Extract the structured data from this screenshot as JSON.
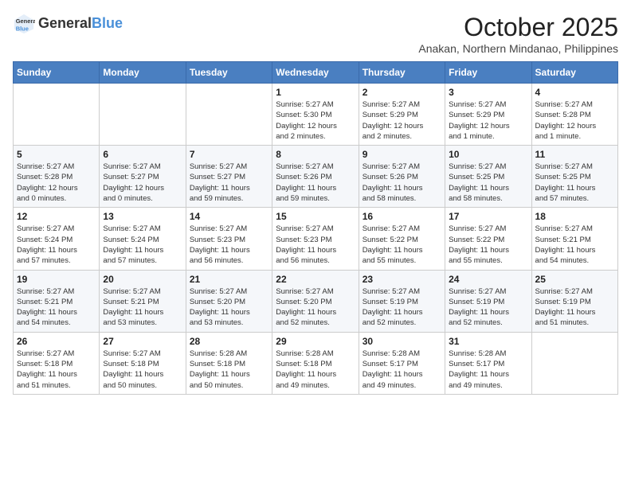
{
  "header": {
    "logo_general": "General",
    "logo_blue": "Blue",
    "month": "October 2025",
    "location": "Anakan, Northern Mindanao, Philippines"
  },
  "days_of_week": [
    "Sunday",
    "Monday",
    "Tuesday",
    "Wednesday",
    "Thursday",
    "Friday",
    "Saturday"
  ],
  "weeks": [
    [
      {
        "day": "",
        "info": ""
      },
      {
        "day": "",
        "info": ""
      },
      {
        "day": "",
        "info": ""
      },
      {
        "day": "1",
        "info": "Sunrise: 5:27 AM\nSunset: 5:30 PM\nDaylight: 12 hours\nand 2 minutes."
      },
      {
        "day": "2",
        "info": "Sunrise: 5:27 AM\nSunset: 5:29 PM\nDaylight: 12 hours\nand 2 minutes."
      },
      {
        "day": "3",
        "info": "Sunrise: 5:27 AM\nSunset: 5:29 PM\nDaylight: 12 hours\nand 1 minute."
      },
      {
        "day": "4",
        "info": "Sunrise: 5:27 AM\nSunset: 5:28 PM\nDaylight: 12 hours\nand 1 minute."
      }
    ],
    [
      {
        "day": "5",
        "info": "Sunrise: 5:27 AM\nSunset: 5:28 PM\nDaylight: 12 hours\nand 0 minutes."
      },
      {
        "day": "6",
        "info": "Sunrise: 5:27 AM\nSunset: 5:27 PM\nDaylight: 12 hours\nand 0 minutes."
      },
      {
        "day": "7",
        "info": "Sunrise: 5:27 AM\nSunset: 5:27 PM\nDaylight: 11 hours\nand 59 minutes."
      },
      {
        "day": "8",
        "info": "Sunrise: 5:27 AM\nSunset: 5:26 PM\nDaylight: 11 hours\nand 59 minutes."
      },
      {
        "day": "9",
        "info": "Sunrise: 5:27 AM\nSunset: 5:26 PM\nDaylight: 11 hours\nand 58 minutes."
      },
      {
        "day": "10",
        "info": "Sunrise: 5:27 AM\nSunset: 5:25 PM\nDaylight: 11 hours\nand 58 minutes."
      },
      {
        "day": "11",
        "info": "Sunrise: 5:27 AM\nSunset: 5:25 PM\nDaylight: 11 hours\nand 57 minutes."
      }
    ],
    [
      {
        "day": "12",
        "info": "Sunrise: 5:27 AM\nSunset: 5:24 PM\nDaylight: 11 hours\nand 57 minutes."
      },
      {
        "day": "13",
        "info": "Sunrise: 5:27 AM\nSunset: 5:24 PM\nDaylight: 11 hours\nand 57 minutes."
      },
      {
        "day": "14",
        "info": "Sunrise: 5:27 AM\nSunset: 5:23 PM\nDaylight: 11 hours\nand 56 minutes."
      },
      {
        "day": "15",
        "info": "Sunrise: 5:27 AM\nSunset: 5:23 PM\nDaylight: 11 hours\nand 56 minutes."
      },
      {
        "day": "16",
        "info": "Sunrise: 5:27 AM\nSunset: 5:22 PM\nDaylight: 11 hours\nand 55 minutes."
      },
      {
        "day": "17",
        "info": "Sunrise: 5:27 AM\nSunset: 5:22 PM\nDaylight: 11 hours\nand 55 minutes."
      },
      {
        "day": "18",
        "info": "Sunrise: 5:27 AM\nSunset: 5:21 PM\nDaylight: 11 hours\nand 54 minutes."
      }
    ],
    [
      {
        "day": "19",
        "info": "Sunrise: 5:27 AM\nSunset: 5:21 PM\nDaylight: 11 hours\nand 54 minutes."
      },
      {
        "day": "20",
        "info": "Sunrise: 5:27 AM\nSunset: 5:21 PM\nDaylight: 11 hours\nand 53 minutes."
      },
      {
        "day": "21",
        "info": "Sunrise: 5:27 AM\nSunset: 5:20 PM\nDaylight: 11 hours\nand 53 minutes."
      },
      {
        "day": "22",
        "info": "Sunrise: 5:27 AM\nSunset: 5:20 PM\nDaylight: 11 hours\nand 52 minutes."
      },
      {
        "day": "23",
        "info": "Sunrise: 5:27 AM\nSunset: 5:19 PM\nDaylight: 11 hours\nand 52 minutes."
      },
      {
        "day": "24",
        "info": "Sunrise: 5:27 AM\nSunset: 5:19 PM\nDaylight: 11 hours\nand 52 minutes."
      },
      {
        "day": "25",
        "info": "Sunrise: 5:27 AM\nSunset: 5:19 PM\nDaylight: 11 hours\nand 51 minutes."
      }
    ],
    [
      {
        "day": "26",
        "info": "Sunrise: 5:27 AM\nSunset: 5:18 PM\nDaylight: 11 hours\nand 51 minutes."
      },
      {
        "day": "27",
        "info": "Sunrise: 5:27 AM\nSunset: 5:18 PM\nDaylight: 11 hours\nand 50 minutes."
      },
      {
        "day": "28",
        "info": "Sunrise: 5:28 AM\nSunset: 5:18 PM\nDaylight: 11 hours\nand 50 minutes."
      },
      {
        "day": "29",
        "info": "Sunrise: 5:28 AM\nSunset: 5:18 PM\nDaylight: 11 hours\nand 49 minutes."
      },
      {
        "day": "30",
        "info": "Sunrise: 5:28 AM\nSunset: 5:17 PM\nDaylight: 11 hours\nand 49 minutes."
      },
      {
        "day": "31",
        "info": "Sunrise: 5:28 AM\nSunset: 5:17 PM\nDaylight: 11 hours\nand 49 minutes."
      },
      {
        "day": "",
        "info": ""
      }
    ]
  ]
}
